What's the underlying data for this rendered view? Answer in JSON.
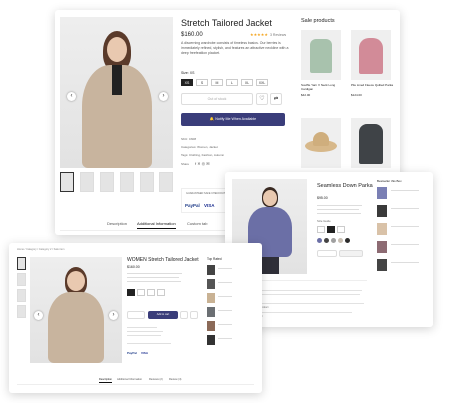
{
  "main": {
    "title": "Stretch Tailored Jacket",
    "price": "$160.00",
    "reviews": "3 Reviews",
    "description": "A discerning wardrobe consists of timeless basics. Our berries is immediately refined, stylish, and features an attractive neckline with a deep freefeatiion placket.",
    "size_label": "Size: XS",
    "sizes": [
      "XS",
      "S",
      "M",
      "L",
      "XL",
      "XXL"
    ],
    "out_of_stock": "Out of stock",
    "notify_button": "Notify Me When Available",
    "sku": "SKU: C608",
    "categories": "Categories: Women, Jacket",
    "tags": "Tags: Clothing, Fashion, Autumn",
    "share": "Share",
    "guaranteed": "GUARANTEED SAFE CHECKOUT",
    "payments": [
      "PayPal",
      "VISA"
    ],
    "tabs": [
      "Description",
      "Additional Information",
      "Custom tab"
    ],
    "sale_title": "Sale products",
    "sale_items": [
      {
        "name": "Souffle Yarn V Neck Long Cardigan",
        "price": "$42.00"
      },
      {
        "name": "Pile Lined Fleece Quilted Parka",
        "price": "$124.00"
      },
      {
        "name": "Packable straw hat",
        "price": ""
      },
      {
        "name": "Blocktech Parka",
        "price": ""
      }
    ]
  },
  "second": {
    "title": "Seamless Down Parka",
    "sidebar_title": "Bestseller this Box",
    "price": "$95.00",
    "description_heading": "Description",
    "note_label": "Size Guide",
    "overview_label": "Feature",
    "spec_lines": [
      "Specification details of the product",
      "Other information to consider"
    ]
  },
  "third": {
    "breadcrumb": "Home / Category / Category 2 / Sale item",
    "title": "WOMEN Stretch Tailored Jacket",
    "price": "$160.00",
    "top_rated": "Top Rated",
    "add_button": "Add to cart",
    "tabs": [
      "Description",
      "Additional Information",
      "Reviews (2)",
      "Review (4)"
    ],
    "payments": [
      "PayPal",
      "VISA"
    ]
  },
  "colors": {
    "accent": "#3a3d7a",
    "coat_beige": "#c8b49e",
    "parka_purple": "#6b6fa6"
  }
}
